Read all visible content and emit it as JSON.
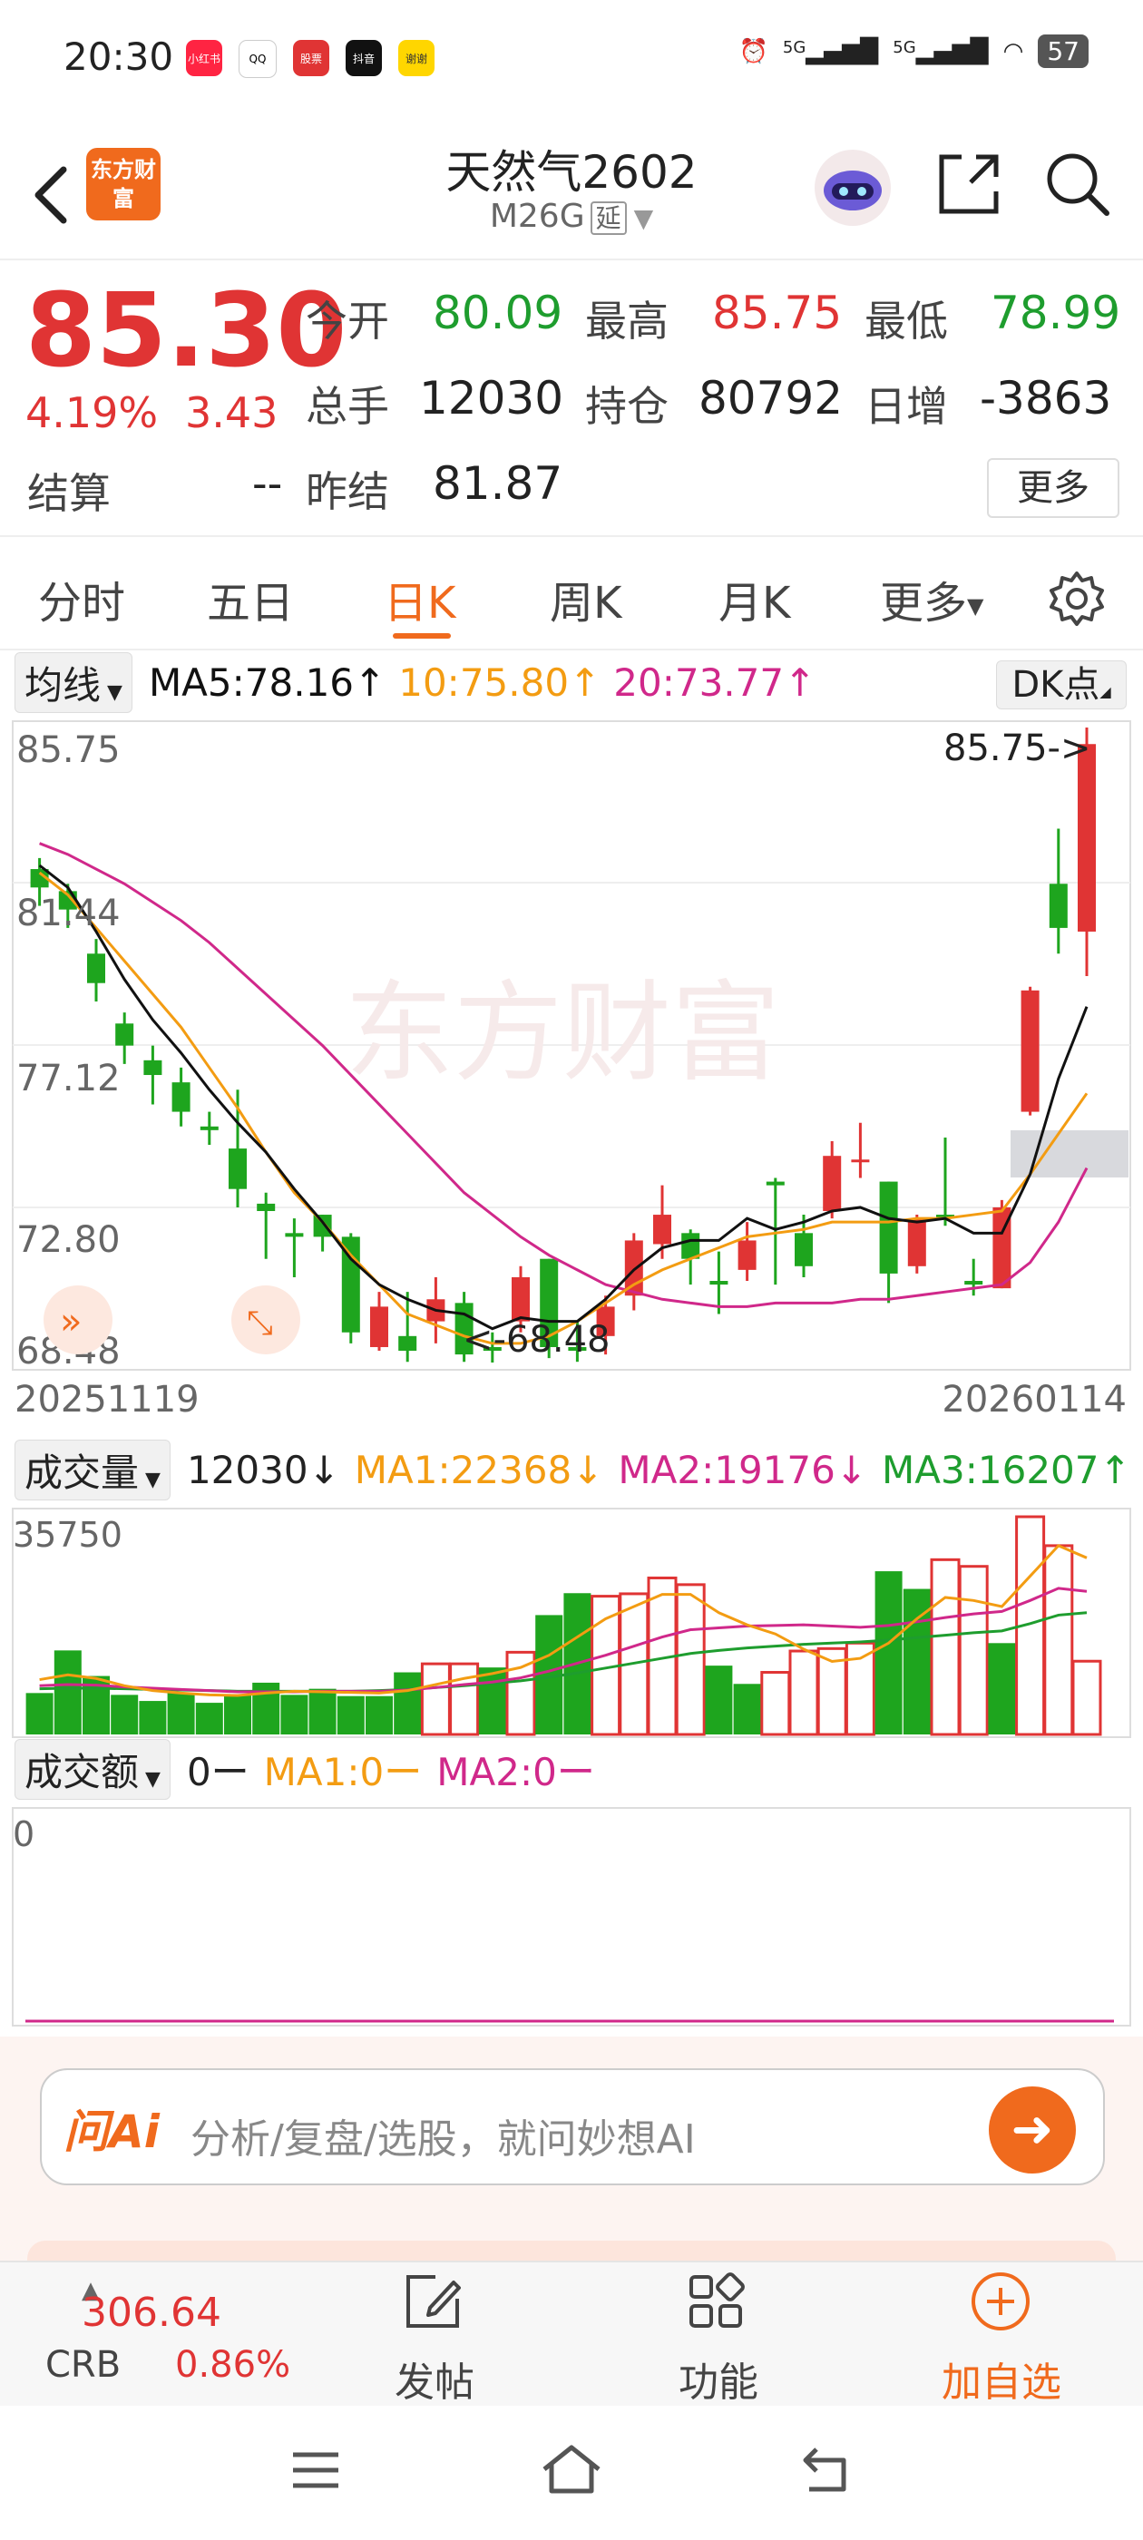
{
  "status_bar": {
    "time": "20:30",
    "apps": [
      "小红书",
      "QQ",
      "股票",
      "抖音",
      "谢谢"
    ],
    "signal1": "5G",
    "signal2": "5G",
    "battery": "57"
  },
  "header": {
    "logo": "东方财富",
    "title": "天然气2602",
    "subtitle": "M26G",
    "delay_tag": "延"
  },
  "quote": {
    "price": "85.30",
    "change_pct": "4.19%",
    "change_abs": "3.43",
    "open_label": "今开",
    "open": "80.09",
    "high_label": "最高",
    "high": "85.75",
    "low_label": "最低",
    "low": "78.99",
    "volume_label": "总手",
    "volume": "12030",
    "position_label": "持仓",
    "position": "80792",
    "daily_inc_label": "日增",
    "daily_inc": "-3863",
    "settle_label": "结算",
    "settle": "--",
    "prev_settle_label": "昨结",
    "prev_settle": "81.87",
    "more_label": "更多"
  },
  "tabs": [
    "分时",
    "五日",
    "日K",
    "周K",
    "月K",
    "更多"
  ],
  "active_tab": "日K",
  "ma_row": {
    "selector": "均线",
    "ma5": "MA5:78.16↑",
    "ma10": "10:75.80↑",
    "ma20": "20:73.77↑",
    "dk": "DK点"
  },
  "colors": {
    "up": "#e03434",
    "down": "#1ea51e",
    "ma5": "#111111",
    "ma10": "#f39c12",
    "ma20": "#d0288a",
    "accent": "#f06a1d"
  },
  "price_axis": [
    "85.75",
    "81.44",
    "77.12",
    "72.80",
    "68.48"
  ],
  "dates": {
    "start": "20251119",
    "end": "20260114"
  },
  "annotations": {
    "high": "85.75->",
    "low": "<-68.48"
  },
  "watermark": "东方财富",
  "volume_row": {
    "selector": "成交量",
    "value": "12030↓",
    "ma1": "MA1:22368↓",
    "ma2": "MA2:19176↓",
    "ma3": "MA3:16207↑",
    "axis_max": "35750"
  },
  "amount_row": {
    "selector": "成交额",
    "value": "0ー",
    "ma1": "MA1:0ー",
    "ma2": "MA2:0ー",
    "axis_max": "0"
  },
  "ai": {
    "logo": "问Ai",
    "placeholder": "分析/复盘/选股，就问妙想AI"
  },
  "bottom": {
    "index_value": "306.64",
    "index_name": "CRB",
    "index_change": "0.86%",
    "post_label": "发帖",
    "func_label": "功能",
    "add_label": "加自选"
  },
  "chart_data": {
    "type": "candlestick",
    "ylim": [
      68.48,
      85.75
    ],
    "candles": [
      {
        "o": 81.9,
        "c": 81.4,
        "h": 82.2,
        "l": 80.9
      },
      {
        "o": 81.3,
        "c": 80.8,
        "h": 81.5,
        "l": 80.3
      },
      {
        "o": 79.6,
        "c": 78.8,
        "h": 80.0,
        "l": 78.3
      },
      {
        "o": 77.7,
        "c": 77.1,
        "h": 78.0,
        "l": 76.6
      },
      {
        "o": 76.7,
        "c": 76.3,
        "h": 77.1,
        "l": 75.5
      },
      {
        "o": 76.1,
        "c": 75.3,
        "h": 76.5,
        "l": 74.9
      },
      {
        "o": 74.9,
        "c": 74.8,
        "h": 75.3,
        "l": 74.4
      },
      {
        "o": 74.3,
        "c": 73.2,
        "h": 75.9,
        "l": 72.7
      },
      {
        "o": 72.8,
        "c": 72.6,
        "h": 73.1,
        "l": 71.3
      },
      {
        "o": 72.0,
        "c": 71.9,
        "h": 72.4,
        "l": 70.8
      },
      {
        "o": 72.5,
        "c": 71.9,
        "h": 72.5,
        "l": 71.5
      },
      {
        "o": 71.9,
        "c": 69.3,
        "h": 72.0,
        "l": 69.0
      },
      {
        "o": 68.9,
        "c": 70.0,
        "h": 70.4,
        "l": 68.8
      },
      {
        "o": 69.2,
        "c": 68.8,
        "h": 70.4,
        "l": 68.5
      },
      {
        "o": 69.6,
        "c": 70.2,
        "h": 70.8,
        "l": 69.0
      },
      {
        "o": 70.1,
        "c": 68.7,
        "h": 70.4,
        "l": 68.5
      },
      {
        "o": 68.9,
        "c": 68.8,
        "h": 69.3,
        "l": 68.48
      },
      {
        "o": 69.6,
        "c": 70.8,
        "h": 71.1,
        "l": 69.3
      },
      {
        "o": 71.3,
        "c": 68.9,
        "h": 71.3,
        "l": 68.6
      },
      {
        "o": 68.9,
        "c": 68.8,
        "h": 69.6,
        "l": 68.5
      },
      {
        "o": 69.2,
        "c": 70.0,
        "h": 70.3,
        "l": 68.7
      },
      {
        "o": 70.3,
        "c": 71.8,
        "h": 72.0,
        "l": 69.9
      },
      {
        "o": 71.7,
        "c": 72.5,
        "h": 73.3,
        "l": 71.3
      },
      {
        "o": 72.0,
        "c": 71.3,
        "h": 72.1,
        "l": 70.6
      },
      {
        "o": 70.7,
        "c": 70.6,
        "h": 71.5,
        "l": 69.8
      },
      {
        "o": 71.0,
        "c": 71.8,
        "h": 72.3,
        "l": 70.7
      },
      {
        "o": 73.4,
        "c": 73.3,
        "h": 73.5,
        "l": 70.6
      },
      {
        "o": 72.0,
        "c": 71.1,
        "h": 72.5,
        "l": 70.8
      },
      {
        "o": 72.6,
        "c": 74.1,
        "h": 74.5,
        "l": 72.4
      },
      {
        "o": 74.0,
        "c": 74.0,
        "h": 75.0,
        "l": 73.5
      },
      {
        "o": 73.4,
        "c": 70.9,
        "h": 73.4,
        "l": 70.1
      },
      {
        "o": 71.1,
        "c": 72.4,
        "h": 72.5,
        "l": 70.9
      },
      {
        "o": 72.5,
        "c": 72.4,
        "h": 74.6,
        "l": 72.2
      },
      {
        "o": 70.7,
        "c": 70.6,
        "h": 71.3,
        "l": 70.3
      },
      {
        "o": 70.5,
        "c": 72.7,
        "h": 72.9,
        "l": 70.5
      },
      {
        "o": 75.3,
        "c": 78.6,
        "h": 78.7,
        "l": 75.2
      },
      {
        "o": 81.5,
        "c": 80.3,
        "h": 83.0,
        "l": 79.6
      },
      {
        "o": 80.2,
        "c": 85.3,
        "h": 85.75,
        "l": 78.99
      }
    ],
    "ma5": [
      82.0,
      81.4,
      80.2,
      78.9,
      77.8,
      76.9,
      75.9,
      75.0,
      74.2,
      73.2,
      72.3,
      71.3,
      70.6,
      70.2,
      69.9,
      69.8,
      69.4,
      69.7,
      69.6,
      69.6,
      70.2,
      71.0,
      71.6,
      71.8,
      71.8,
      72.4,
      72.1,
      72.3,
      72.6,
      72.7,
      72.4,
      72.3,
      72.4,
      72.0,
      72.0,
      73.6,
      76.2,
      78.16
    ],
    "ma10": [
      81.8,
      81.2,
      80.3,
      79.4,
      78.5,
      77.6,
      76.5,
      75.4,
      74.2,
      73.1,
      72.3,
      71.4,
      70.6,
      69.8,
      69.5,
      69.2,
      69.0,
      69.0,
      69.2,
      69.6,
      70.1,
      70.6,
      71.0,
      71.3,
      71.6,
      71.9,
      72.0,
      72.1,
      72.3,
      72.3,
      72.3,
      72.4,
      72.4,
      72.5,
      72.6,
      73.6,
      74.7,
      75.8
    ],
    "ma20": [
      82.6,
      82.3,
      81.9,
      81.5,
      81.0,
      80.5,
      79.9,
      79.2,
      78.5,
      77.8,
      77.1,
      76.3,
      75.5,
      74.7,
      73.9,
      73.1,
      72.5,
      71.9,
      71.4,
      71.0,
      70.6,
      70.4,
      70.2,
      70.1,
      70.0,
      70.0,
      70.1,
      70.1,
      70.1,
      70.2,
      70.2,
      70.3,
      70.4,
      70.5,
      70.6,
      71.2,
      72.3,
      73.77
    ],
    "volume": {
      "max": 35750,
      "values": [
        6800,
        13800,
        9600,
        6500,
        5500,
        6800,
        5200,
        6500,
        8500,
        6500,
        7500,
        6300,
        6300,
        10200,
        11600,
        11600,
        11000,
        13500,
        19600,
        23200,
        22700,
        23100,
        25700,
        24600,
        11300,
        8300,
        10200,
        13700,
        14100,
        15000,
        26800,
        23900,
        28700,
        27600,
        15000,
        35750,
        31000,
        12030
      ],
      "up": [
        false,
        false,
        false,
        false,
        false,
        false,
        false,
        false,
        false,
        false,
        false,
        false,
        false,
        false,
        true,
        true,
        false,
        true,
        false,
        false,
        true,
        true,
        true,
        true,
        false,
        false,
        true,
        true,
        true,
        true,
        false,
        false,
        true,
        true,
        false,
        true,
        true,
        true
      ],
      "ma1": [
        9000,
        9800,
        9200,
        8000,
        7200,
        6800,
        6500,
        6400,
        6800,
        7100,
        7000,
        6900,
        6800,
        7200,
        8200,
        9200,
        10000,
        11000,
        13000,
        16000,
        19000,
        21000,
        23000,
        23000,
        20000,
        18000,
        16500,
        14000,
        12000,
        12500,
        15000,
        19000,
        22500,
        22000,
        21000,
        26000,
        31000,
        29000
      ],
      "ma2": [
        8000,
        8200,
        8100,
        7800,
        7600,
        7400,
        7200,
        7000,
        7000,
        7000,
        7100,
        7100,
        7100,
        7300,
        7700,
        8200,
        8600,
        9300,
        10400,
        11700,
        13000,
        14500,
        16000,
        17200,
        17500,
        17800,
        17900,
        18000,
        17800,
        17600,
        17900,
        18500,
        19200,
        19800,
        20200,
        22000,
        24000,
        23500
      ],
      "ma3": [
        7500,
        7600,
        7600,
        7500,
        7400,
        7300,
        7200,
        7100,
        7100,
        7100,
        7100,
        7100,
        7200,
        7400,
        7700,
        8000,
        8400,
        8800,
        9400,
        10100,
        10900,
        11700,
        12500,
        13300,
        13800,
        14200,
        14500,
        14800,
        15000,
        15200,
        15500,
        15900,
        16300,
        16700,
        17000,
        18200,
        19600,
        20000
      ]
    }
  }
}
